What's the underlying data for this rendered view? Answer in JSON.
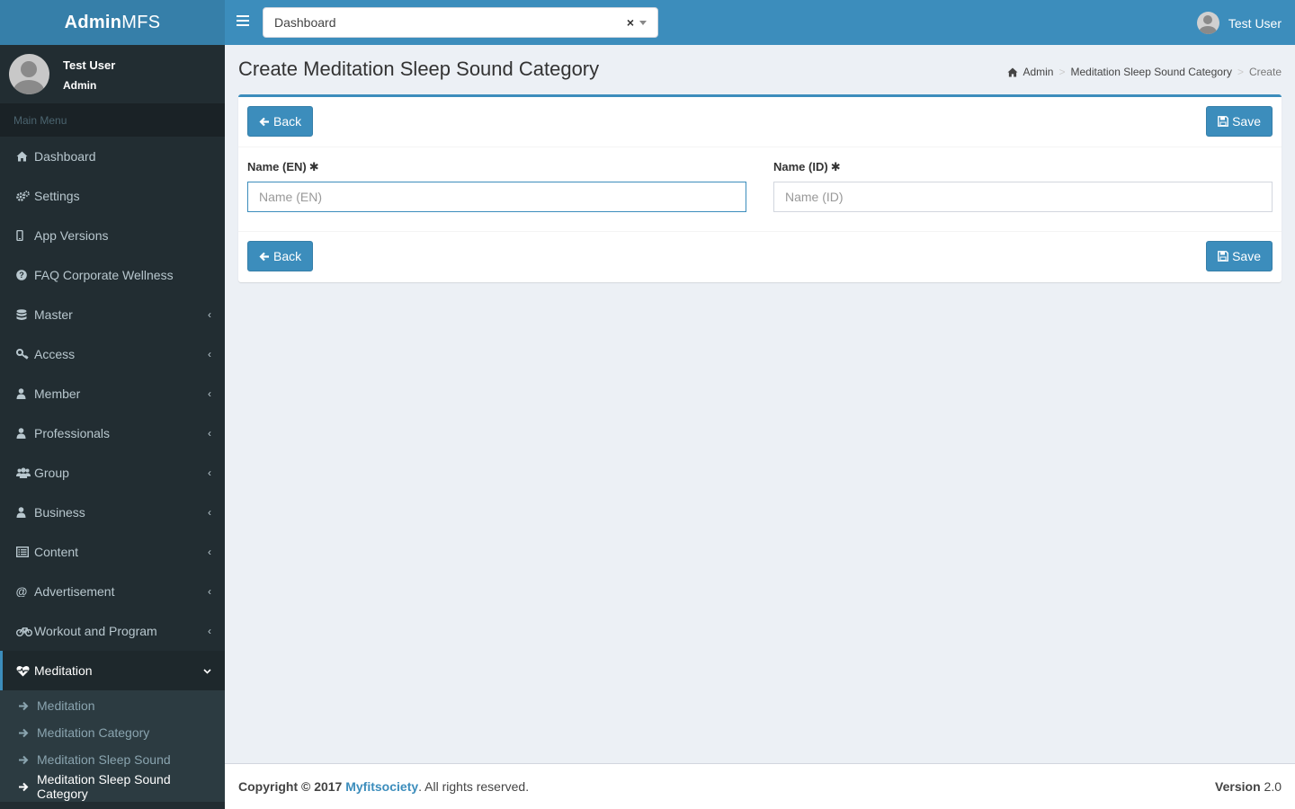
{
  "app": {
    "logo_bold": "Admin",
    "logo_light": "MFS"
  },
  "sidebar": {
    "user_name": "Test User",
    "user_role": "Admin",
    "menu_header": "Main Menu",
    "items": [
      {
        "label": "Dashboard",
        "icon": "home-icon"
      },
      {
        "label": "Settings",
        "icon": "gears-icon"
      },
      {
        "label": "App Versions",
        "icon": "mobile-icon"
      },
      {
        "label": "FAQ Corporate Wellness",
        "icon": "question-circle-icon"
      },
      {
        "label": "Master",
        "icon": "database-icon"
      },
      {
        "label": "Access",
        "icon": "key-icon"
      },
      {
        "label": "Member",
        "icon": "user-icon"
      },
      {
        "label": "Professionals",
        "icon": "user-icon"
      },
      {
        "label": "Group",
        "icon": "users-icon"
      },
      {
        "label": "Business",
        "icon": "user-icon"
      },
      {
        "label": "Content",
        "icon": "list-alt-icon"
      },
      {
        "label": "Advertisement",
        "icon": "at-icon"
      },
      {
        "label": "Workout and Program",
        "icon": "bicycle-icon"
      },
      {
        "label": "Meditation",
        "icon": "heartbeat-icon"
      }
    ],
    "submenu": [
      {
        "label": "Meditation"
      },
      {
        "label": "Meditation Category"
      },
      {
        "label": "Meditation Sleep Sound"
      },
      {
        "label": "Meditation Sleep Sound Category"
      }
    ]
  },
  "navbar": {
    "select_value": "Dashboard",
    "clear_symbol": "×",
    "user_name": "Test User"
  },
  "content": {
    "title": "Create Meditation Sleep Sound Category",
    "breadcrumb": [
      "Admin",
      "Meditation Sleep Sound Category",
      "Create"
    ],
    "breadcrumb_sep": ">",
    "back_label": "Back",
    "save_label": "Save",
    "fields": [
      {
        "label": "Name (EN)",
        "required_mark": "✱",
        "placeholder": "Name (EN)",
        "value": ""
      },
      {
        "label": "Name (ID)",
        "required_mark": "✱",
        "placeholder": "Name (ID)",
        "value": ""
      }
    ]
  },
  "footer": {
    "copyright_prefix": "Copyright © 2017",
    "brand": "Myfitsociety",
    "copyright_suffix": ". All rights reserved.",
    "version_label": "Version",
    "version_value": "2.0"
  },
  "colors": {
    "primary": "#3c8dbc",
    "logo_bg": "#367fa9",
    "sidebar_bg": "#222d32",
    "content_bg": "#ecf0f5"
  }
}
